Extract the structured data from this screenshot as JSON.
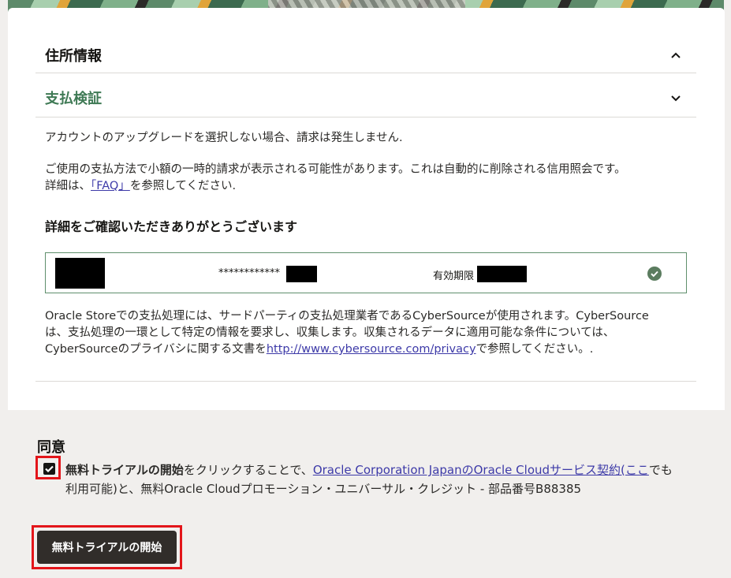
{
  "accordion": {
    "address": {
      "title": "住所情報"
    },
    "payment": {
      "title": "支払検証",
      "title_color": "#3f7a55"
    }
  },
  "payment": {
    "no_charge_text": "アカウントのアップグレードを選択しない場合、請求は発生しません.",
    "temp_charge_line1": "ご使用の支払方法で小額の一時的請求が表示される可能性があります。これは自動的に削除される信用照会です。",
    "temp_charge_line2_prefix": "詳細は、",
    "faq_link": "「FAQ」",
    "temp_charge_line2_suffix": "を参照してください.",
    "confirm_title": "詳細をご確認いただきありがとうございます",
    "card": {
      "masked_number": "************",
      "expiry_label": "有効期限"
    },
    "cybersource_line1": "Oracle Storeでの支払処理には、サードパーティの支払処理業者であるCyberSourceが使用されます。CyberSource",
    "cybersource_line2": "は、支払処理の一環として特定の情報を要求し、収集します。収集されるデータに適用可能な条件については、",
    "cybersource_line3_prefix": "CyberSourceのプライバシに関する文書を",
    "cybersource_link": "http://www.cybersource.com/privacy",
    "cybersource_line3_suffix": "で参照してください。."
  },
  "agreement": {
    "title": "同意",
    "checkbox_checked": true,
    "bold_text": "無料トライアルの開始",
    "text_1": "をクリックすることで、",
    "link_contract": "Oracle Corporation JapanのOracle Cloudサービス契約",
    "paren_open": "(",
    "link_here": "ここ",
    "text_2": "でも",
    "line2": "利用可能)と、無料Oracle Cloudプロモーション・ユニバーサル・クレジット - 部品番号B88385"
  },
  "actions": {
    "start_trial_button": "無料トライアルの開始"
  },
  "colors": {
    "accent_green": "#3f7a55",
    "highlight_red": "#e3151a",
    "button_dark": "#312d2a",
    "link": "#3d3aa8"
  }
}
